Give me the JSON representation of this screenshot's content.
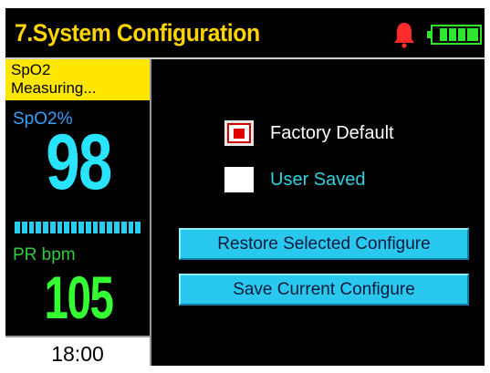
{
  "header": {
    "title": "7.System Configuration",
    "alarm_icon": "bell-icon",
    "battery_icon": "battery-icon",
    "accent_color": "#ffd400"
  },
  "left_panel": {
    "spo2_header_line1": "SpO2",
    "spo2_header_line2": "Measuring...",
    "spo2_label": "SpO2%",
    "spo2_value": "98",
    "pr_label": "PR bpm",
    "pr_value": "105",
    "clock": "18:00",
    "colors": {
      "spo2": "#29e4ff",
      "pr": "#33ff33",
      "header_bg": "#ffe600"
    }
  },
  "options": [
    {
      "label": "Factory Default",
      "selected": true
    },
    {
      "label": "User Saved",
      "selected": false
    }
  ],
  "buttons": {
    "restore": "Restore Selected Configure",
    "save": "Save Current Configure",
    "color": "#29c8ef"
  }
}
